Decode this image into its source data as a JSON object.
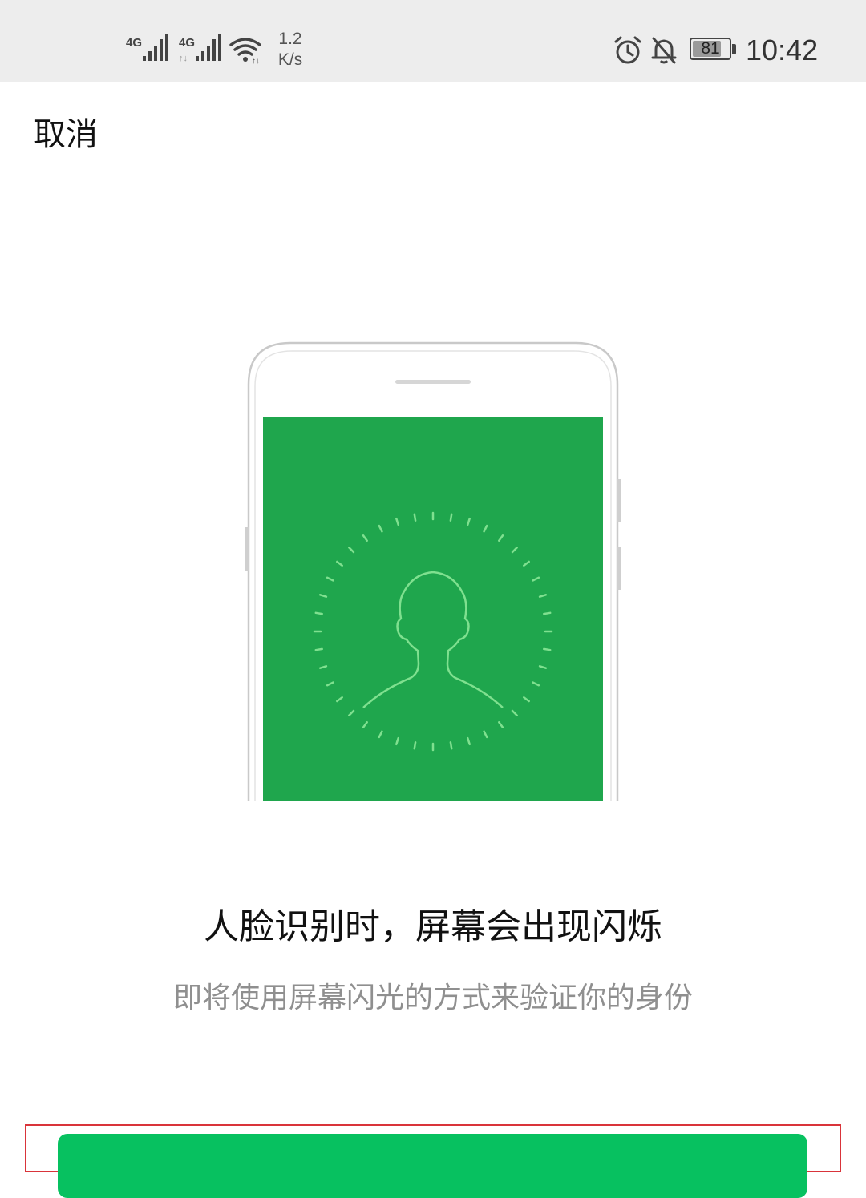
{
  "status_bar": {
    "network_1": "4G",
    "network_2": "4G",
    "net_speed_value": "1.2",
    "net_speed_unit": "K/s",
    "battery_percent": 81,
    "battery_label": "81",
    "time": "10:42",
    "icons": [
      "signal-icon",
      "signal-icon",
      "wifi-icon",
      "alarm-icon",
      "bell-muted-icon",
      "battery-icon"
    ]
  },
  "nav": {
    "cancel_label": "取消"
  },
  "illustration": {
    "icon": "face-recognition-phone-icon",
    "screen_color": "#1fa64d",
    "accent_color": "#7fe08f"
  },
  "content": {
    "headline": "人脸识别时，屏幕会出现闪烁",
    "subline": "即将使用屏幕闪光的方式来验证你的身份"
  },
  "actions": {
    "primary_button_color": "#07c160",
    "highlight_color": "#d9343a"
  }
}
